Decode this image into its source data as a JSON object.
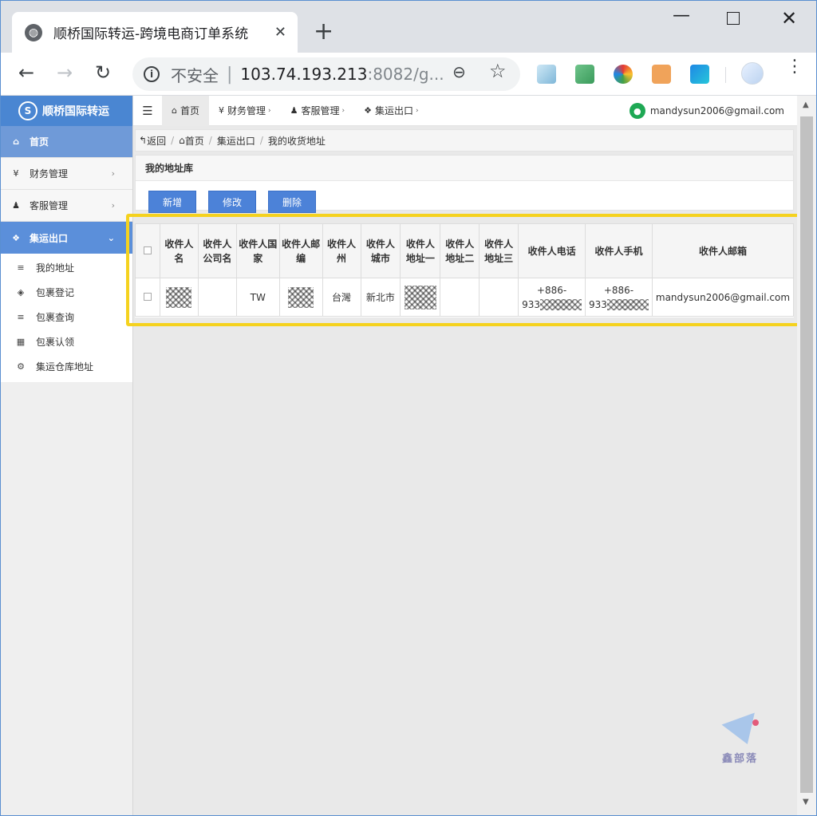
{
  "browser": {
    "tab_title": "顺桥国际转运-跨境电商订单系统",
    "tab_close": "✕",
    "new_tab": "+",
    "security_label": "不安全",
    "url_host": "103.74.193.213",
    "url_rest": ":8082/g...",
    "icons": [
      "globe-icon",
      "back-icon",
      "forward-icon",
      "reload-icon",
      "info-icon",
      "zoom-icon",
      "star-icon",
      "menu-dots-icon"
    ]
  },
  "sidebar": {
    "brand": "顺桥国际转运",
    "items": [
      {
        "label": "首页",
        "icon": "home-icon"
      },
      {
        "label": "财务管理",
        "icon": "yen-icon"
      },
      {
        "label": "客服管理",
        "icon": "user-icon"
      },
      {
        "label": "集运出口",
        "icon": "cubes-icon"
      }
    ],
    "submenu": [
      {
        "label": "我的地址",
        "icon": "list-icon"
      },
      {
        "label": "包裹登记",
        "icon": "box-icon"
      },
      {
        "label": "包裹查询",
        "icon": "list-icon"
      },
      {
        "label": "包裹认领",
        "icon": "grid-icon"
      },
      {
        "label": "集运仓库地址",
        "icon": "gear-icon"
      }
    ]
  },
  "topnav": {
    "items": [
      {
        "label": "首页"
      },
      {
        "label": "财务管理"
      },
      {
        "label": "客服管理"
      },
      {
        "label": "集运出口"
      }
    ],
    "user_email": "mandysun2006@gmail.com"
  },
  "breadcrumb": {
    "back": "返回",
    "items": [
      "首页",
      "集运出口",
      "我的收货地址"
    ]
  },
  "panel": {
    "title": "我的地址库",
    "buttons": {
      "add": "新增",
      "edit": "修改",
      "delete": "删除"
    }
  },
  "table": {
    "headers": [
      "收件人名",
      "收件人公司名",
      "收件人国家",
      "收件人邮编",
      "收件人州",
      "收件人城市",
      "收件人地址一",
      "收件人地址二",
      "收件人地址三",
      "收件人电话",
      "收件人手机",
      "收件人邮箱"
    ],
    "row": {
      "country": "TW",
      "state": "台灣",
      "city": "新北市",
      "phone_prefix": "+886-",
      "phone_partial": "933",
      "mobile_prefix": "+886-",
      "mobile_partial": "933",
      "email": "mandysun2006@gmail.com"
    }
  },
  "watermark": {
    "text": "鑫部落"
  },
  "colors": {
    "accent": "#4a86d2",
    "highlight": "#f5d21e",
    "user_icon": "#1ea854"
  }
}
